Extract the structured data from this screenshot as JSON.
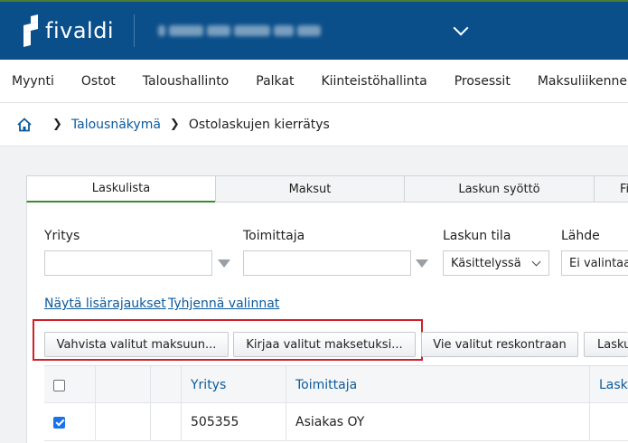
{
  "header": {
    "brand": "fivaldi",
    "company_redacted": true
  },
  "nav": {
    "items": [
      "Myynti",
      "Ostot",
      "Taloushallinto",
      "Palkat",
      "Kiinteistöhallinta",
      "Prosessit",
      "Maksuliikenne"
    ]
  },
  "breadcrumb": {
    "link": "Talousnäkymä",
    "current": "Ostolaskujen kierrätys"
  },
  "tabs": {
    "items": [
      "Laskulista",
      "Maksut",
      "Laskun syöttö",
      "Fi"
    ],
    "active": "Laskulista"
  },
  "filters": {
    "yritys_label": "Yritys",
    "yritys_value": "",
    "toimittaja_label": "Toimittaja",
    "toimittaja_value": "",
    "laskun_tila_label": "Laskun tila",
    "laskun_tila_value": "Käsittelyssä",
    "lahde_label": "Lähde",
    "lahde_value": "Ei valintaa"
  },
  "links": {
    "show_more": "Näytä lisärajaukset",
    "clear": "Tyhjennä valinnat"
  },
  "actions": {
    "confirm_payment": "Vahvista valitut maksuun...",
    "record_payment": "Kirjaa valitut maksetuksi...",
    "export_ledger": "Vie valitut reskontraan",
    "partial": "Lasku"
  },
  "table": {
    "headers": [
      "",
      "",
      "",
      "Yritys",
      "Toimittaja",
      "Lasku"
    ],
    "rows": [
      {
        "checked": true,
        "yritys": "505355",
        "toimittaja": "Asiakas OY"
      }
    ]
  },
  "colors": {
    "header_bg": "#0b4f8a",
    "link": "#0b5a9c",
    "active_tab_accent": "#3a8a2e",
    "highlight": "#d0202a"
  }
}
